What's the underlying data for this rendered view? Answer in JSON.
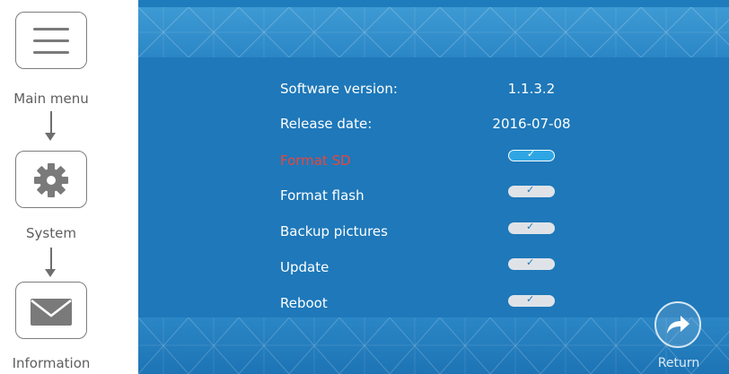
{
  "nav": {
    "steps": [
      {
        "label": "Main menu",
        "icon": "menu-icon"
      },
      {
        "label": "System",
        "icon": "gear-icon"
      },
      {
        "label": "Information",
        "icon": "envelope-icon"
      }
    ]
  },
  "info": {
    "software_version": {
      "label": "Software version:",
      "value": "1.1.3.2"
    },
    "release_date": {
      "label": "Release date:",
      "value": "2016-07-08"
    }
  },
  "actions": [
    {
      "label": "Format SD",
      "selected": true
    },
    {
      "label": "Format flash",
      "selected": false
    },
    {
      "label": "Backup pictures",
      "selected": false
    },
    {
      "label": "Update",
      "selected": false
    },
    {
      "label": "Reboot",
      "selected": false
    }
  ],
  "return_button": {
    "label": "Return",
    "icon": "return-arrow-icon"
  },
  "colors": {
    "panel_blue": "#1e78b9",
    "band_blue": "#3e9ad3",
    "selected_red": "#e8463f",
    "toggle_selected": "#2fa6e4",
    "toggle_default": "#dfe3e8"
  }
}
